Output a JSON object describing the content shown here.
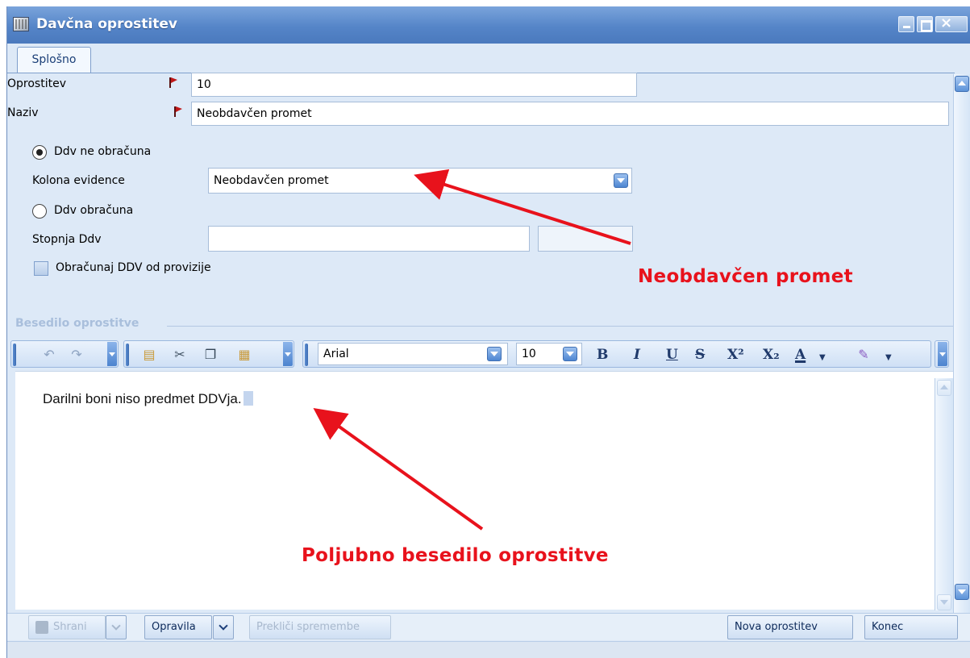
{
  "window": {
    "title": "Davčna oprostitev"
  },
  "tabs": [
    {
      "label": "Splošno"
    }
  ],
  "form": {
    "oprostitev_label": "Oprostitev",
    "oprostitev_value": "10",
    "naziv_label": "Naziv",
    "naziv_value": "Neobdavčen promet",
    "radio_ne_obracuna": "Ddv ne obračuna",
    "kolona_label": "Kolona evidence",
    "kolona_value": "Neobdavčen promet",
    "radio_obracuna": "Ddv obračuna",
    "stopnja_label": "Stopnja Ddv",
    "stopnja_value": "",
    "checkbox_label": "Obračunaj DDV od provizije"
  },
  "editor": {
    "section_title": "Besedilo oprostitve",
    "font": "Arial",
    "size": "10",
    "text": "Darilni boni niso predmet DDVja."
  },
  "buttons": {
    "save": "Shrani",
    "tasks": "Opravila",
    "cancel_changes": "Prekliči spremembe",
    "new": "Nova oprostitev",
    "close": "Konec"
  },
  "annotations": {
    "first": "Neobdavčen promet",
    "second": "Poljubno besedilo oprostitve"
  },
  "colors": {
    "annotation": "#e8121c",
    "title_bar": "#5585c8"
  }
}
